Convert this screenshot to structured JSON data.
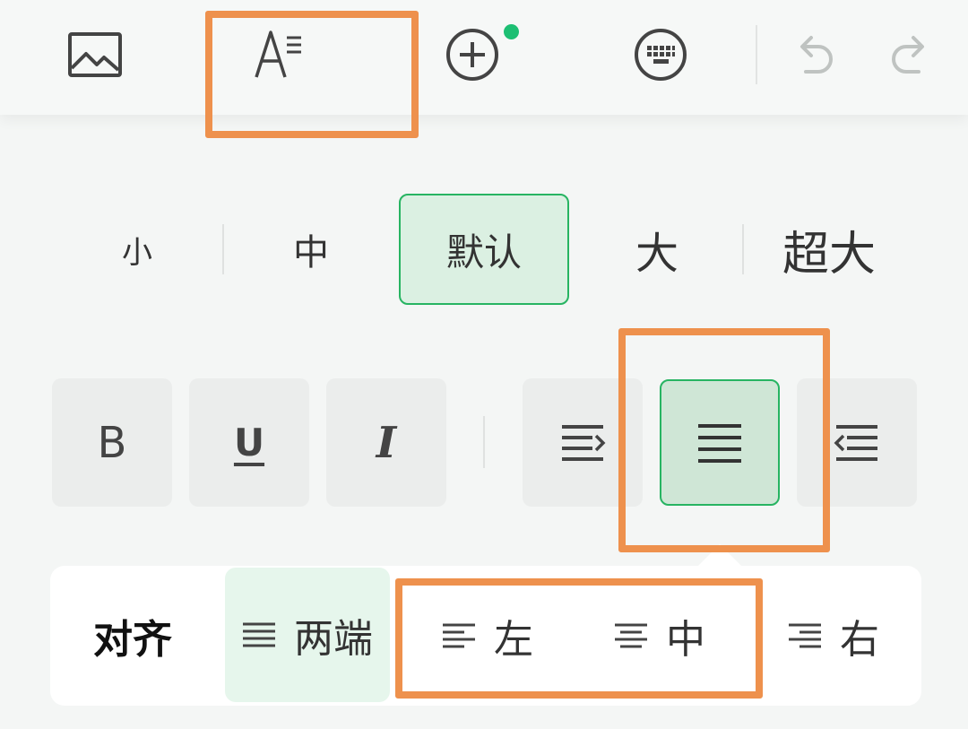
{
  "toolbar": {
    "icons": [
      "image-icon",
      "text-format-icon",
      "add-circle-icon",
      "keyboard-icon",
      "undo-icon",
      "redo-icon"
    ],
    "accent_dot_color": "#1dbf73"
  },
  "size_row": {
    "items": [
      "小",
      "中",
      "默认",
      "大",
      "超大"
    ],
    "selected": "默认"
  },
  "format_row": {
    "bold": "B",
    "underline": "U",
    "italic": "I",
    "icons": [
      "indent-icon",
      "align-justify-icon",
      "outdent-icon"
    ],
    "selected": "align-justify-icon"
  },
  "align_popup": {
    "title": "对齐",
    "options": [
      "两端",
      "左",
      "中",
      "右"
    ],
    "selected": "两端"
  },
  "colors": {
    "accent_green": "#27b462",
    "selected_bg": "#dbf0e2",
    "highlight_orange": "#ee914d"
  }
}
